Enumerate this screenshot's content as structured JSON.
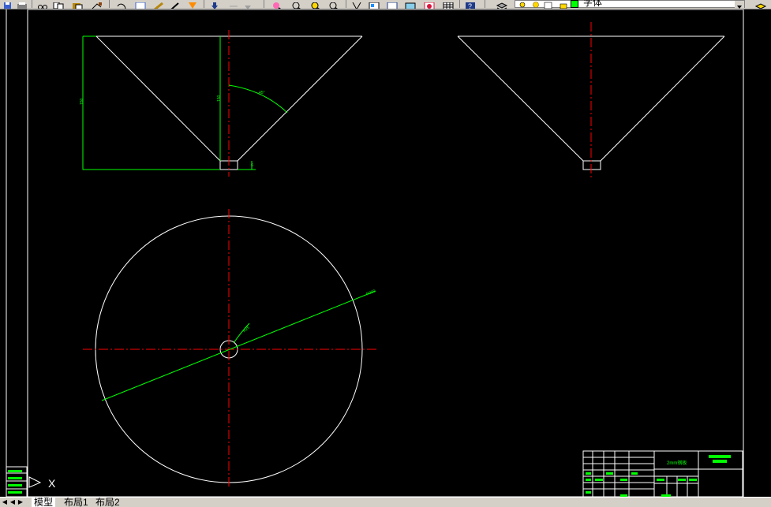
{
  "colors": {
    "background": "#000000",
    "geometry": "#ffffff",
    "dimension": "#00ff00",
    "centerline": "#ff0000",
    "toolbar": "#d4d0c8"
  },
  "toolbar": {
    "icons": [
      "save-icon",
      "print-icon",
      "cut-icon",
      "copy-icon",
      "paste-icon",
      "undo-icon",
      "redo-icon",
      "pan-icon",
      "zoom-realtime-icon",
      "zoom-window-icon",
      "zoom-previous-icon",
      "properties-icon",
      "design-center-icon",
      "tool-palettes-icon",
      "table-icon",
      "help-icon",
      "layer-manager-icon"
    ],
    "layer_name": "字体"
  },
  "drawing": {
    "front_view": {
      "angle_label": "45°",
      "height_label": "150",
      "inner_height_label": "150",
      "small_label": "6"
    },
    "plan_view": {
      "radius_label": "R300",
      "hole_label": "R25"
    },
    "title_block": {
      "title": "2mm钢板",
      "company": ""
    },
    "ucs": {
      "x_label": "X"
    }
  },
  "tabs": [
    {
      "label": "模型",
      "active": true
    },
    {
      "label": "布局1",
      "active": false
    },
    {
      "label": "布局2",
      "active": false
    }
  ]
}
